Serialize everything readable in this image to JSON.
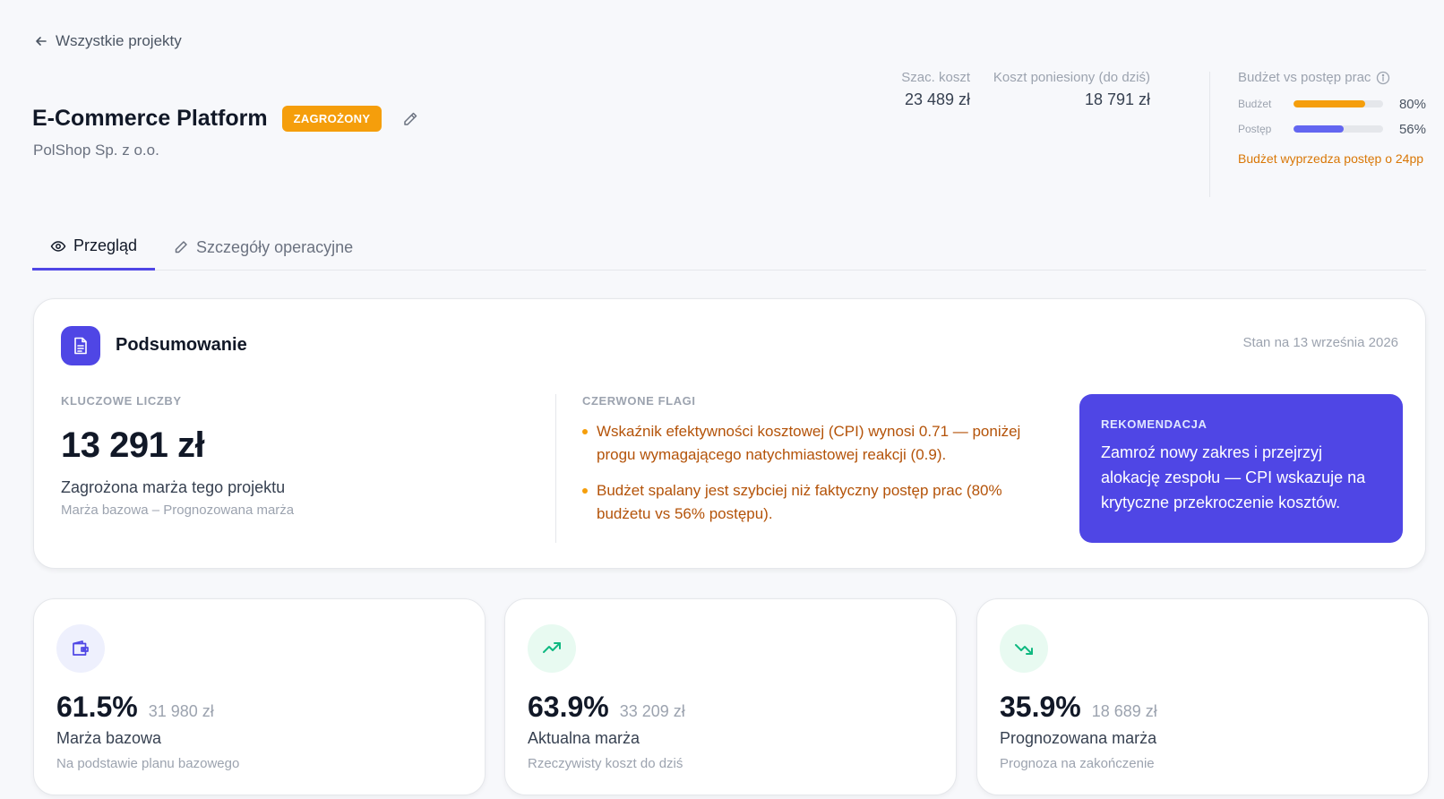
{
  "nav": {
    "back_label": "Wszystkie projekty"
  },
  "project": {
    "title": "E-Commerce Platform",
    "status": "ZAGROŻONY",
    "client": "PolShop Sp. z o.o."
  },
  "costs": {
    "estimated_label": "Szac. koszt",
    "estimated_value": "23 489 zł",
    "incurred_label": "Koszt poniesiony (do dziś)",
    "incurred_value": "18 791 zł"
  },
  "budget_vs_progress": {
    "title": "Budżet vs postęp prac",
    "budget_label": "Budżet",
    "budget_pct": "80%",
    "budget_value": 0.8,
    "budget_color": "#f59e0b",
    "progress_label": "Postęp",
    "progress_pct": "56%",
    "progress_value": 0.56,
    "progress_color": "#6366f1",
    "note": "Budżet wyprzedza postęp o 24pp"
  },
  "tabs": [
    {
      "label": "Przegląd",
      "icon": "eye-icon",
      "active": true
    },
    {
      "label": "Szczegóły operacyjne",
      "icon": "pencil-icon",
      "active": false
    }
  ],
  "summary": {
    "title": "Podsumowanie",
    "date": "Stan na 13 września 2026",
    "key_label": "KLUCZOWE LICZBY",
    "key_value": "13 291 zł",
    "key_desc": "Zagrożona marża tego projektu",
    "key_sub": "Marża bazowa – Prognozowana marża",
    "flags_label": "CZERWONE FLAGI",
    "flags": [
      "Wskaźnik efektywności kosztowej (CPI) wynosi 0.71 — poniżej progu wymagającego natychmiastowej reakcji (0.9).",
      "Budżet spalany jest szybciej niż faktyczny postęp prac (80% budżetu vs 56% postępu)."
    ],
    "reco_label": "REKOMENDACJA",
    "reco_text": "Zamroź nowy zakres i przejrzyj alokację zespołu — CPI wskazuje na krytyczne przekroczenie kosztów."
  },
  "metrics": [
    {
      "pct": "61.5%",
      "amount": "31 980 zł",
      "label": "Marża bazowa",
      "sub": "Na podstawie planu bazowego",
      "icon": "wallet-icon"
    },
    {
      "pct": "63.9%",
      "amount": "33 209 zł",
      "label": "Aktualna marża",
      "sub": "Rzeczywisty koszt do dziś",
      "icon": "trend-up-icon"
    },
    {
      "pct": "35.9%",
      "amount": "18 689 zł",
      "label": "Prognozowana marża",
      "sub": "Prognoza na zakończenie",
      "icon": "trend-down-icon"
    }
  ]
}
